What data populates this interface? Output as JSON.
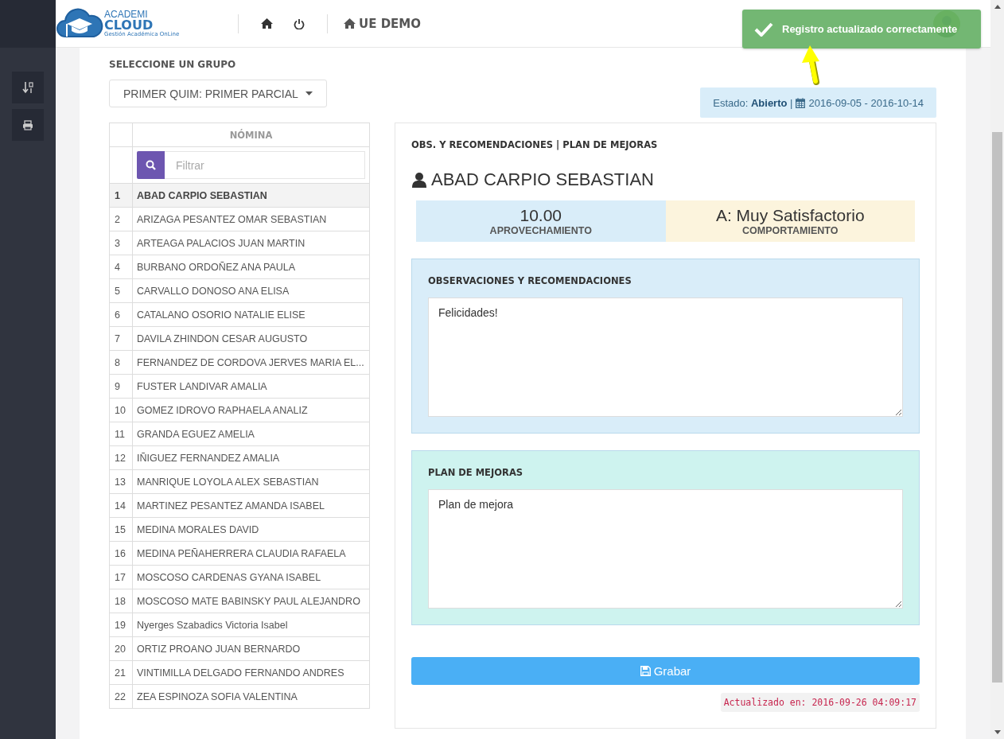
{
  "logo": {
    "line_1": "ACADEMI",
    "line_2": "CLOUD",
    "tagline": "Gestión Académica OnLine"
  },
  "header": {
    "school": "UE DEMO"
  },
  "toast": {
    "message": "Registro actualizado correctamente"
  },
  "group_label": "SELECCIONE UN GRUPO",
  "group_select": "PRIMER QUIM: PRIMER PARCIAL",
  "status": {
    "text": "Estado: **Abierto** |",
    "dates": "2016-09-05 - 2016-10-14"
  },
  "roster": {
    "header": "NÓMINA",
    "filter_placeholder": "Filtrar",
    "rows": [
      {
        "number": "1",
        "name": "ABAD CARPIO SEBASTIAN",
        "selected": true
      },
      {
        "number": "2",
        "name": "ARIZAGA PESANTEZ OMAR SEBASTIAN",
        "selected": false
      },
      {
        "number": "3",
        "name": "ARTEAGA PALACIOS JUAN MARTIN",
        "selected": false
      },
      {
        "number": "4",
        "name": "BURBANO ORDOÑEZ ANA PAULA",
        "selected": false
      },
      {
        "number": "5",
        "name": "CARVALLO DONOSO ANA ELISA",
        "selected": false
      },
      {
        "number": "6",
        "name": "CATALANO OSORIO NATALIE ELISE",
        "selected": false
      },
      {
        "number": "7",
        "name": "DAVILA ZHINDON CESAR AUGUSTO",
        "selected": false
      },
      {
        "number": "8",
        "name": "FERNANDEZ DE CORDOVA JERVES MARIA EL...",
        "selected": false
      },
      {
        "number": "9",
        "name": "FUSTER LANDIVAR AMALIA",
        "selected": false
      },
      {
        "number": "10",
        "name": "GOMEZ IDROVO RAPHAELA ANALIZ",
        "selected": false
      },
      {
        "number": "11",
        "name": "GRANDA EGUEZ AMELIA",
        "selected": false
      },
      {
        "number": "12",
        "name": "IÑIGUEZ FERNANDEZ AMALIA",
        "selected": false
      },
      {
        "number": "13",
        "name": "MANRIQUE LOYOLA ALEX SEBASTIAN",
        "selected": false
      },
      {
        "number": "14",
        "name": "MARTINEZ PESANTEZ AMANDA ISABEL",
        "selected": false
      },
      {
        "number": "15",
        "name": "MEDINA MORALES DAVID",
        "selected": false
      },
      {
        "number": "16",
        "name": "MEDINA PEÑAHERRERA CLAUDIA RAFAELA",
        "selected": false
      },
      {
        "number": "17",
        "name": "MOSCOSO CARDENAS GYANA ISABEL",
        "selected": false
      },
      {
        "number": "18",
        "name": "MOSCOSO MATE BABINSKY PAUL ALEJANDRO",
        "selected": false
      },
      {
        "number": "19",
        "name": "Nyerges Szabadics Victoria Isabel",
        "selected": false
      },
      {
        "number": "20",
        "name": "ORTIZ PROANO JUAN BERNARDO",
        "selected": false
      },
      {
        "number": "21",
        "name": "VINTIMILLA DELGADO FERNANDO ANDRES",
        "selected": false
      },
      {
        "number": "22",
        "name": "ZEA ESPINOZA SOFIA VALENTINA",
        "selected": false
      }
    ]
  },
  "detail": {
    "title": "OBS. Y RECOMENDACIONES | PLAN DE MEJORAS",
    "student": "ABAD CARPIO SEBASTIAN",
    "scores": [
      {
        "value": "10.00",
        "label": "APROVECHAMIENTO",
        "color": "#d9edf9"
      },
      {
        "value": "A: Muy Satisfactorio",
        "label": "COMPORTAMIENTO",
        "color": "#fcf4dd"
      }
    ],
    "sections": [
      {
        "title": "OBSERVACIONES Y RECOMENDACIONES",
        "text": "Felicidades!",
        "color": "#d9edf9"
      },
      {
        "title": "PLAN DE MEJORAS",
        "text": "Plan de mejora",
        "color": "#cef3ef"
      }
    ],
    "save_button": "Grabar",
    "updated": "Actualizado en: 2016-09-26 04:09:17"
  }
}
